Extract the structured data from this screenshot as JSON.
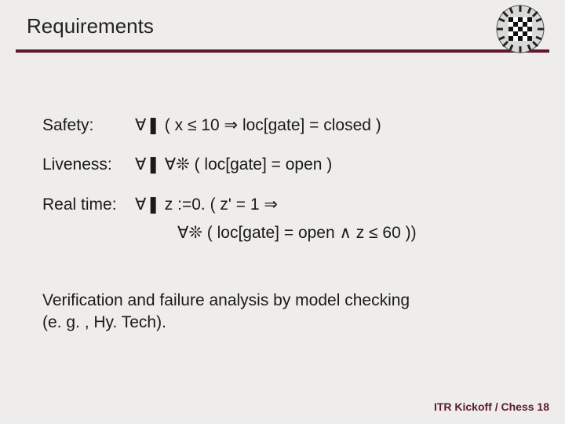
{
  "title": "Requirements",
  "rows": {
    "safety": {
      "label": "Safety:",
      "expr": "∀❚  ( x ≤ 10  ⇒  loc[gate] = closed )"
    },
    "liveness": {
      "label": "Liveness:",
      "expr": "∀❚  ∀❊ ( loc[gate] = open )"
    },
    "realtime": {
      "label": "Real time:",
      "line1": "∀❚  z :=0. ( z' = 1  ⇒",
      "line2": "∀❊ ( loc[gate] = open  ∧  z ≤ 60 ))"
    }
  },
  "verification": {
    "l1": "Verification and failure analysis by model checking",
    "l2": "(e. g. , Hy. Tech)."
  },
  "footer": "ITR Kickoff / Chess  18"
}
